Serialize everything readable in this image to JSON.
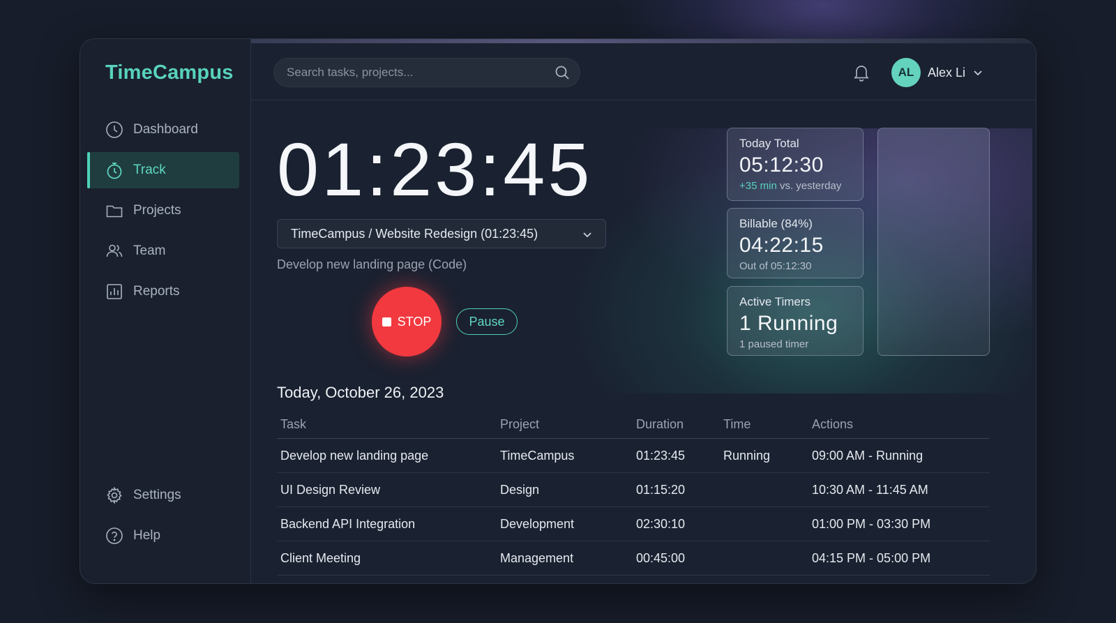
{
  "app": {
    "name": "TimeCampus"
  },
  "sidebar": {
    "items": [
      {
        "label": "Dashboard",
        "icon": "clock-icon"
      },
      {
        "label": "Track",
        "icon": "stopwatch-icon",
        "active": true
      },
      {
        "label": "Projects",
        "icon": "folder-icon"
      },
      {
        "label": "Team",
        "icon": "users-icon"
      },
      {
        "label": "Reports",
        "icon": "bar-chart-icon"
      }
    ],
    "bottom_items": [
      {
        "label": "Settings",
        "icon": "gear-icon"
      },
      {
        "label": "Help",
        "icon": "help-circle-icon"
      }
    ]
  },
  "header": {
    "search_placeholder": "Search tasks, projects...",
    "user": {
      "initials": "AL",
      "name": "Alex Li"
    }
  },
  "timer": {
    "display": "01:23:45",
    "project_selected": "TimeCampus / Website Redesign (01:23:45)",
    "task_description": "Develop new landing page (Code)",
    "stop_label": "STOP",
    "pause_label": "Pause"
  },
  "stats": {
    "today": {
      "label": "Today Total",
      "value": "05:12:30",
      "delta": "+35 min",
      "delta_suffix": " vs. yesterday"
    },
    "billable": {
      "label": "Billable (84%)",
      "value": "04:22:15",
      "sub": "Out of 05:12:30"
    },
    "active": {
      "label": "Active Timers",
      "value": "1 Running",
      "sub": "1 paused timer"
    }
  },
  "log": {
    "date": "Today, October 26, 2023",
    "columns": [
      "Task",
      "Project",
      "Duration",
      "Time",
      "Actions"
    ],
    "rows": [
      {
        "task": "Develop new landing page",
        "project": "TimeCampus",
        "duration": "01:23:45",
        "time": "Running",
        "actions": "09:00 AM - Running"
      },
      {
        "task": "UI Design Review",
        "project": "Design",
        "duration": "01:15:20",
        "time": "",
        "actions": "10:30 AM - 11:45 AM"
      },
      {
        "task": "Backend API Integration",
        "project": "Development",
        "duration": "02:30:10",
        "time": "",
        "actions": "01:00 PM - 03:30 PM"
      },
      {
        "task": "Client Meeting",
        "project": "Management",
        "duration": "00:45:00",
        "time": "",
        "actions": "04:15 PM - 05:00 PM"
      }
    ]
  },
  "colors": {
    "accent": "#58d2bd",
    "stop": "#f2393f",
    "background": "#171d2a"
  }
}
